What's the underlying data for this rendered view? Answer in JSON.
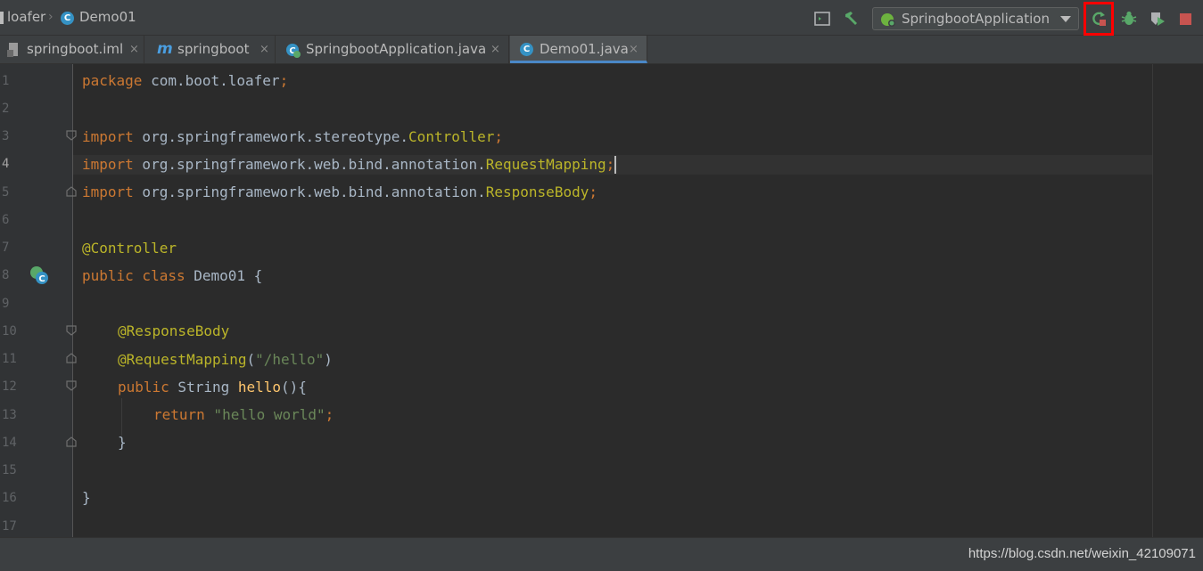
{
  "breadcrumb": {
    "project": "loafer",
    "file": "Demo01",
    "class_badge": "C"
  },
  "toolbar": {
    "run_config": "SpringbootApplication"
  },
  "tabs": [
    {
      "label": "springboot.iml",
      "close": "×"
    },
    {
      "label": "springboot",
      "icon_letter": "m",
      "close": "×"
    },
    {
      "label": "SpringbootApplication.java",
      "close": "×"
    },
    {
      "label": "Demo01.java",
      "close": "×",
      "icon_letter": "C"
    }
  ],
  "line_numbers": [
    "1",
    "2",
    "3",
    "4",
    "5",
    "6",
    "7",
    "8",
    "9",
    "10",
    "11",
    "12",
    "13",
    "14",
    "15",
    "16",
    "17"
  ],
  "code": {
    "l1": {
      "kw": "package",
      "rest": " com.boot.loafer",
      "semi": ";"
    },
    "l3": {
      "kw": "import",
      "rest": " org.springframework.stereotype.",
      "cls": "Controller",
      "semi": ";"
    },
    "l4": {
      "kw": "import",
      "rest": " org.springframework.web.bind.annotation.",
      "cls": "RequestMapping",
      "semi": ";"
    },
    "l5": {
      "kw": "import",
      "rest": " org.springframework.web.bind.annotation.",
      "cls": "ResponseBody",
      "semi": ";"
    },
    "l7": {
      "an": "@Controller"
    },
    "l8": {
      "kw1": "public",
      "kw2": " class",
      "rest": " Demo01 {"
    },
    "l10": {
      "an": "@ResponseBody"
    },
    "l11": {
      "an": "@RequestMapping",
      "p1": "(",
      "str": "\"/hello\"",
      "p2": ")"
    },
    "l12": {
      "kw": "public",
      "rest": " String ",
      "fn": "hello",
      "tail": "(){"
    },
    "l13": {
      "kw": "return",
      "str": " \"hello world\"",
      "semi": ";"
    },
    "l14": {
      "rest": "}"
    },
    "l16": {
      "rest": "}"
    }
  },
  "gutter_badge": "C",
  "watermark": "https://blog.csdn.net/weixin_42109071",
  "colors": {
    "bg": "#2b2b2b",
    "keyword": "#cc7832",
    "annotation": "#bbb529",
    "string": "#6a8759",
    "function": "#ffc66d",
    "text": "#a9b7c6",
    "highlight_box": "#ff0000"
  }
}
